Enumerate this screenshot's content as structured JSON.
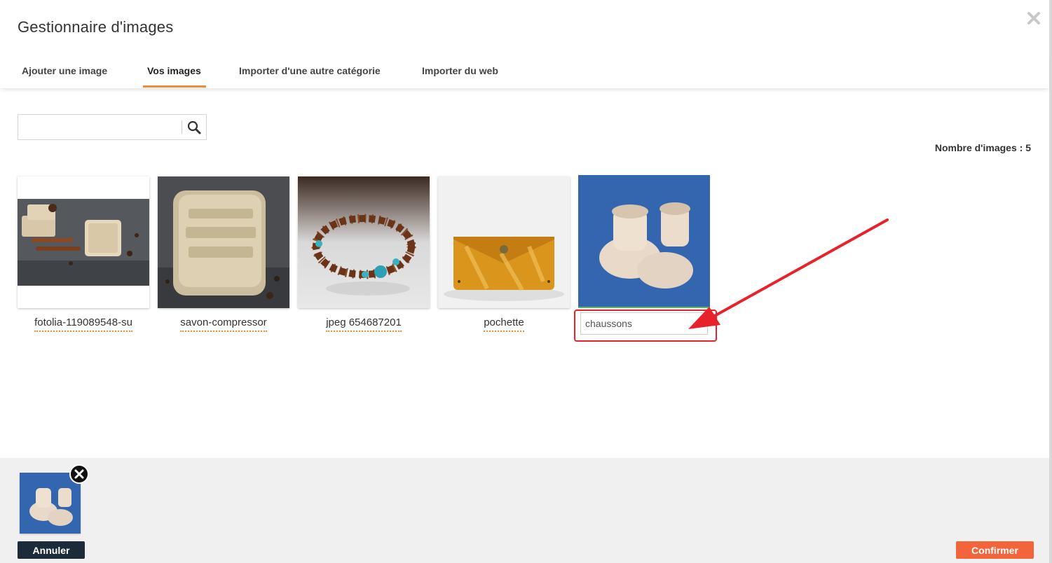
{
  "dialog": {
    "title": "Gestionnaire d'images",
    "close_icon": "close-icon"
  },
  "tabs": [
    {
      "label": "Ajouter une image",
      "active": false
    },
    {
      "label": "Vos images",
      "active": true
    },
    {
      "label": "Importer d'une autre catégorie",
      "active": false
    },
    {
      "label": "Importer du web",
      "active": false
    }
  ],
  "search": {
    "value": "",
    "placeholder": "",
    "icon": "search-icon"
  },
  "image_count": "Nombre d'images : 5",
  "images": [
    {
      "caption": "fotolia-119089548-su",
      "subject": "soap bars with star anise and cinnamon"
    },
    {
      "caption": "savon-compressor",
      "subject": "square soap stamped 100% hand made"
    },
    {
      "caption": "jpeg 654687201",
      "subject": "wooden and turquoise bead bracelet"
    },
    {
      "caption": "pochette",
      "subject": "yellow leather pouch"
    },
    {
      "caption": "chaussons",
      "subject": "knitted baby booties on blue background",
      "editing": true
    }
  ],
  "selected": {
    "subject": "baby booties thumbnail",
    "remove_icon": "remove-icon"
  },
  "buttons": {
    "cancel": "Annuler",
    "confirm": "Confirmer"
  },
  "colors": {
    "accent": "#f08a3c",
    "confirm": "#f2653b",
    "cancel": "#1c2b3a",
    "annotation": "#e8222b"
  }
}
